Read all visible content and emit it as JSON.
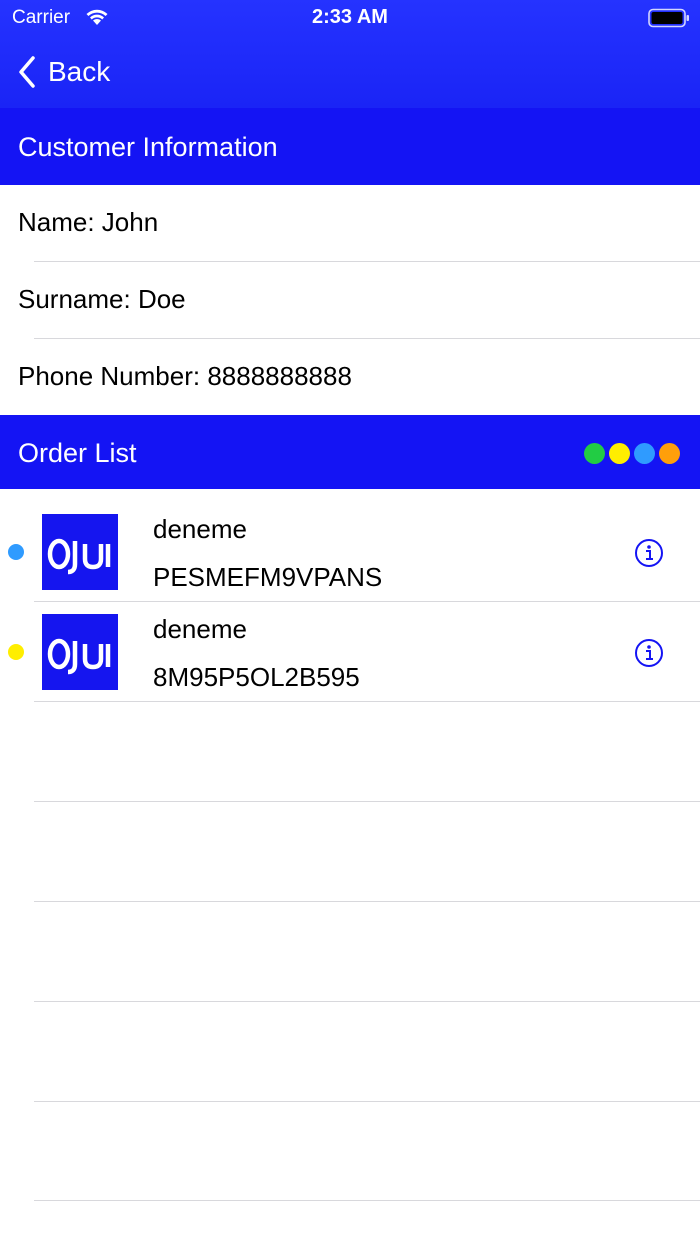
{
  "status_bar": {
    "carrier": "Carrier",
    "time": "2:33 AM"
  },
  "nav": {
    "back_label": "Back"
  },
  "customer_section": {
    "title": "Customer Information",
    "rows": [
      {
        "label": "Name:   John"
      },
      {
        "label": "Surname:   Doe"
      },
      {
        "label": "Phone Number:   8888888888"
      }
    ]
  },
  "order_section": {
    "title": "Order List",
    "legend_colors": [
      "#22cc44",
      "#ffee00",
      "#2f9bff",
      "#ff9f0a"
    ]
  },
  "orders": [
    {
      "name": "deneme",
      "code": "PESMEFM9VPANS",
      "status_color": "#2f9bff",
      "thumbnail": "Oju"
    },
    {
      "name": "deneme",
      "code": "8M95P5OL2B595",
      "status_color": "#ffee00",
      "thumbnail": "Oju"
    }
  ],
  "colors": {
    "accent": "#1414f4",
    "nav": "#2533ff"
  }
}
